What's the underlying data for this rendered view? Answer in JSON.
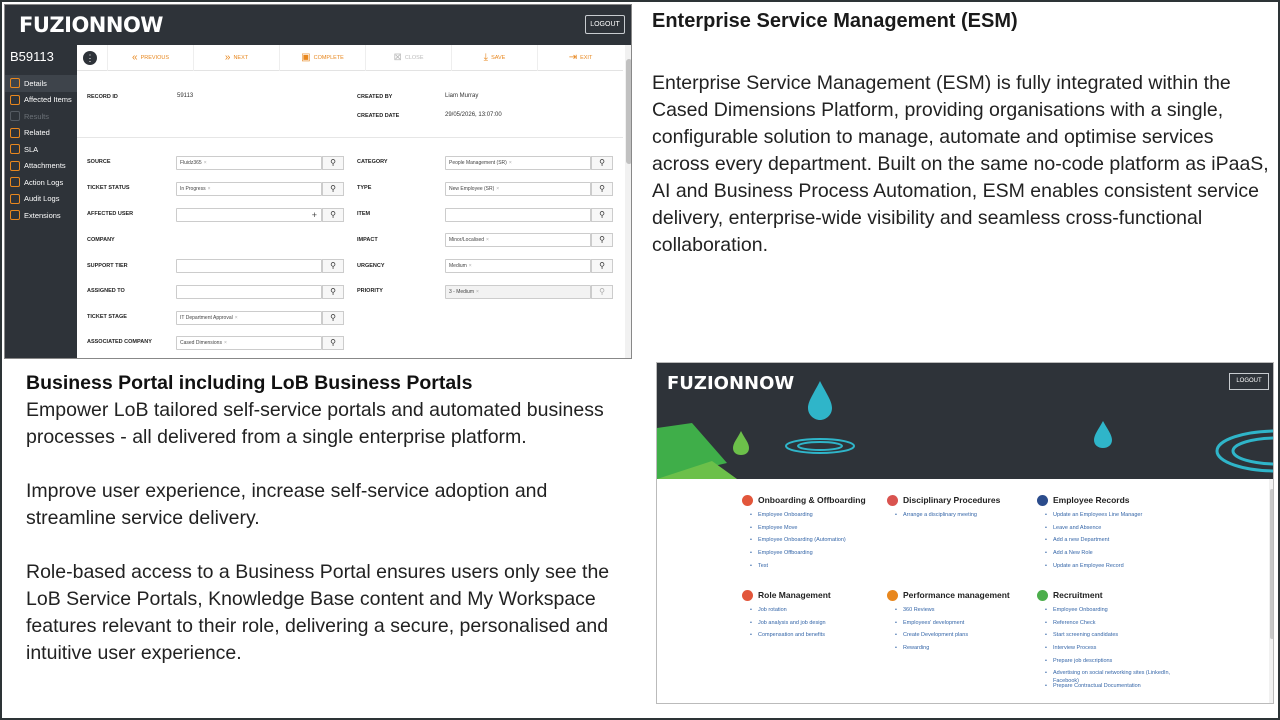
{
  "app": {
    "logo": "FUZIONNOW",
    "logout": "LOGOUT",
    "record_number": "B59113",
    "sidebar": [
      {
        "label": "Details",
        "active": true,
        "dim": false
      },
      {
        "label": "Affected Items",
        "active": false,
        "dim": false
      },
      {
        "label": "Results",
        "active": false,
        "dim": true
      },
      {
        "label": "Related",
        "active": false,
        "dim": false
      },
      {
        "label": "SLA",
        "active": false,
        "dim": false
      },
      {
        "label": "Attachments",
        "active": false,
        "dim": false
      },
      {
        "label": "Action Logs",
        "active": false,
        "dim": false
      },
      {
        "label": "Audit Logs",
        "active": false,
        "dim": false
      },
      {
        "label": "Extensions",
        "active": false,
        "dim": false
      }
    ],
    "toolbar": {
      "more": "⋮",
      "previous": "PREVIOUS",
      "next": "NEXT",
      "complete": "COMPLETE",
      "close": "CLOSE",
      "save": "SAVE",
      "exit": "EXIT"
    },
    "record": {
      "record_id_label": "RECORD ID",
      "record_id": "59113",
      "created_by_label": "CREATED BY",
      "created_by": "Liam Murray",
      "created_date_label": "CREATED DATE",
      "created_date": "29/05/2026, 13:07:00"
    },
    "fields": {
      "source_label": "SOURCE",
      "source": "Fluidz365",
      "ticket_status_label": "TICKET STATUS",
      "ticket_status": "In Progress",
      "affected_user_label": "AFFECTED USER",
      "company_label": "COMPANY",
      "support_tier_label": "SUPPORT TIER",
      "assigned_to_label": "ASSIGNED TO",
      "ticket_stage_label": "TICKET STAGE",
      "ticket_stage": "IT Department Approval",
      "assoc_company_label": "ASSOCIATED COMPANY",
      "assoc_company": "Cased Dimensions",
      "category_label": "CATEGORY",
      "category": "People Management (SR)",
      "type_label": "TYPE",
      "type": "New Employee (SR)",
      "item_label": "ITEM",
      "impact_label": "IMPACT",
      "impact": "Minor/Localised",
      "urgency_label": "URGENCY",
      "urgency": "Medium",
      "priority_label": "PRIORITY",
      "priority": "3 - Medium"
    }
  },
  "esm": {
    "title": "Enterprise Service Management (ESM)",
    "body": "Enterprise Service Management (ESM) is fully integrated within the Cased Dimensions Platform, providing organisations with a single, configurable solution to manage, automate and optimise services across every department. Built on the same no-code platform as iPaaS, AI and Business Process Automation, ESM enables consistent service delivery, enterprise-wide visibility and seamless cross-functional collaboration."
  },
  "portal_text": {
    "title": "Business Portal including LoB Business Portals",
    "p1": "Empower LoB tailored self-service portals and automated business processes - all delivered from a single enterprise platform.",
    "p2": "Improve user experience, increase self-service adoption and streamline service delivery.",
    "p3": "Role-based access to a Business Portal ensures users only see the LoB Service Portals, Knowledge Base content and My Workspace features relevant to their role, delivering a secure, personalised and intuitive user experience."
  },
  "portal": {
    "logo": "FUZIONNOW",
    "logout": "LOGOUT",
    "categories": [
      {
        "title": "Onboarding & Offboarding",
        "color": "#e2563b",
        "items": [
          "Employee Onboarding",
          "Employee Move",
          "Employee Onboarding (Automation)",
          "Employee Offboarding",
          "Test"
        ]
      },
      {
        "title": "Disciplinary Procedures",
        "color": "#d9534f",
        "items": [
          "Arrange a disciplinary meeting"
        ]
      },
      {
        "title": "Employee Records",
        "color": "#2b4c8c",
        "items": [
          "Update an Employees Line Manager",
          "Leave and Absence",
          "Add a new Department",
          "Add a New Role",
          "Update an Employee Record"
        ]
      },
      {
        "title": "Role Management",
        "color": "#e2563b",
        "items": [
          "Job rotation",
          "Job analysis and job design",
          "Compensation and benefits"
        ]
      },
      {
        "title": "Performance management",
        "color": "#e8871e",
        "items": [
          "360 Reviews",
          "Employees' development",
          "Create Development plans",
          "Rewarding"
        ]
      },
      {
        "title": "Recruitment",
        "color": "#4cae4c",
        "items": [
          "Employee Onboarding",
          "Reference Check",
          "Start screening candidates",
          "Interview Process",
          "Prepare job descriptions",
          "Advertising on social networking sites (LinkedIn, Facebook)",
          "Prepare Contractual Documentation"
        ]
      }
    ]
  }
}
